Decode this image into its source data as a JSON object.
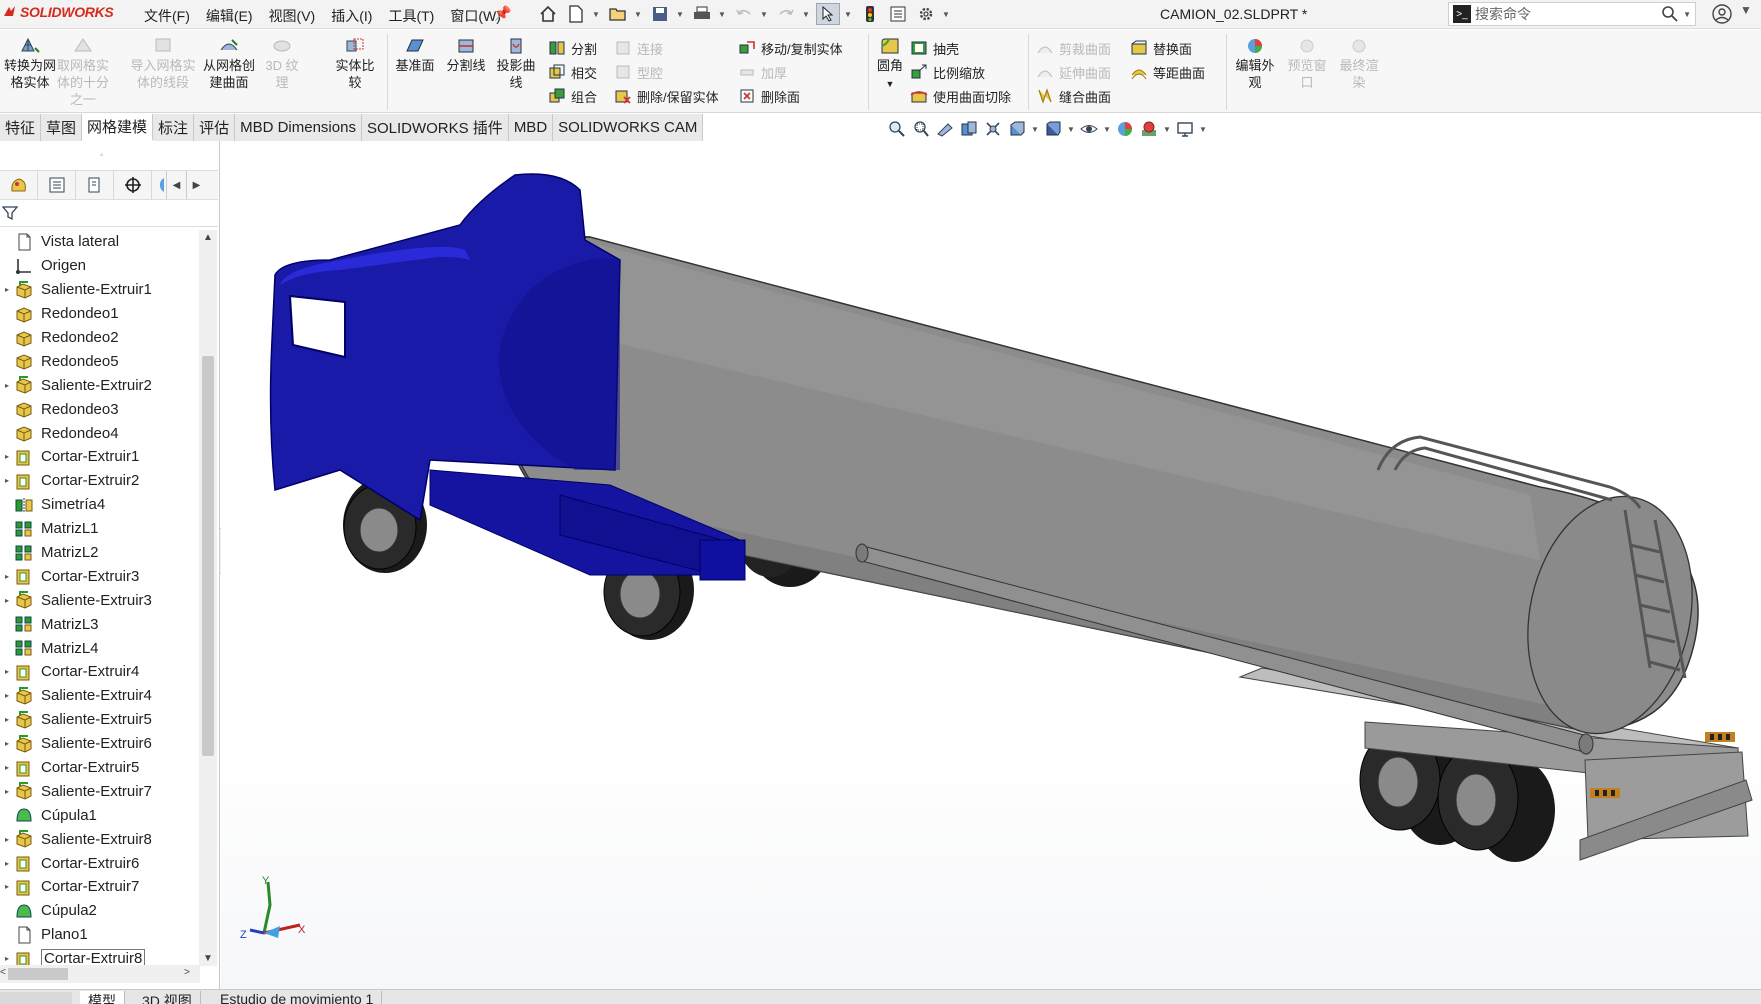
{
  "app": {
    "logo": "SOLIDWORKS",
    "document_title": "CAMION_02.SLDPRT *"
  },
  "menu": [
    "文件(F)",
    "编辑(E)",
    "视图(V)",
    "插入(I)",
    "工具(T)",
    "窗口(W)"
  ],
  "search": {
    "placeholder": "搜索命令"
  },
  "ribbon": {
    "big_buttons": [
      {
        "label1": "转换为网",
        "label2": "格实体",
        "enabled": true
      },
      {
        "label1": "取网格实",
        "label2": "体的十分之一",
        "enabled": false
      },
      {
        "label1": "导入网格实",
        "label2": "体的线段",
        "enabled": false
      },
      {
        "label1": "从网格创",
        "label2": "建曲面",
        "enabled": true
      },
      {
        "label1": "3D 纹",
        "label2": "理",
        "enabled": false
      },
      {
        "label1": "实体比",
        "label2": "较",
        "enabled": true
      },
      {
        "label1": "基准面",
        "label2": "",
        "enabled": true
      },
      {
        "label1": "分割线",
        "label2": "",
        "enabled": true
      },
      {
        "label1": "投影曲",
        "label2": "线",
        "enabled": true
      }
    ],
    "col1": [
      {
        "label": "分割",
        "enabled": true
      },
      {
        "label": "相交",
        "enabled": true
      },
      {
        "label": "组合",
        "enabled": true
      }
    ],
    "col2": [
      {
        "label": "连接",
        "enabled": false
      },
      {
        "label": "型腔",
        "enabled": false
      },
      {
        "label": "删除/保留实体",
        "enabled": true
      }
    ],
    "col3": [
      {
        "label": "移动/复制实体",
        "enabled": true
      },
      {
        "label": "加厚",
        "enabled": false
      },
      {
        "label": "删除面",
        "enabled": true
      }
    ],
    "fillet": {
      "label": "圆角"
    },
    "col4": [
      {
        "label": "抽壳",
        "enabled": true
      },
      {
        "label": "比例缩放",
        "enabled": true
      },
      {
        "label": "使用曲面切除",
        "enabled": true
      }
    ],
    "col5": [
      {
        "label": "剪裁曲面",
        "enabled": false
      },
      {
        "label": "延伸曲面",
        "enabled": false
      },
      {
        "label": "缝合曲面",
        "enabled": true
      }
    ],
    "col6": [
      {
        "label": "替换面",
        "enabled": true
      },
      {
        "label": "等距曲面",
        "enabled": true
      }
    ],
    "right_buttons": [
      {
        "label1": "编辑外",
        "label2": "观",
        "enabled": true
      },
      {
        "label1": "预览窗",
        "label2": "口",
        "enabled": false
      },
      {
        "label1": "最终渲",
        "label2": "染",
        "enabled": false
      }
    ]
  },
  "tabs": [
    "特征",
    "草图",
    "网格建模",
    "标注",
    "评估",
    "MBD Dimensions",
    "SOLIDWORKS 插件",
    "MBD",
    "SOLIDWORKS CAM"
  ],
  "active_tab": "网格建模",
  "feature_tree": [
    {
      "label": "Vista lateral",
      "icon": "annotation-view",
      "expandable": false
    },
    {
      "label": "Origen",
      "icon": "origin",
      "expandable": false
    },
    {
      "label": "Saliente-Extruir1",
      "icon": "boss-extrude",
      "expandable": true
    },
    {
      "label": "Redondeo1",
      "icon": "fillet",
      "expandable": false
    },
    {
      "label": "Redondeo2",
      "icon": "fillet",
      "expandable": false
    },
    {
      "label": "Redondeo5",
      "icon": "fillet",
      "expandable": false
    },
    {
      "label": "Saliente-Extruir2",
      "icon": "boss-extrude",
      "expandable": true
    },
    {
      "label": "Redondeo3",
      "icon": "fillet",
      "expandable": false
    },
    {
      "label": "Redondeo4",
      "icon": "fillet",
      "expandable": false
    },
    {
      "label": "Cortar-Extruir1",
      "icon": "cut-extrude",
      "expandable": true
    },
    {
      "label": "Cortar-Extruir2",
      "icon": "cut-extrude",
      "expandable": true
    },
    {
      "label": "Simetría4",
      "icon": "mirror",
      "expandable": false
    },
    {
      "label": "MatrizL1",
      "icon": "linear-pattern",
      "expandable": false
    },
    {
      "label": "MatrizL2",
      "icon": "linear-pattern",
      "expandable": false
    },
    {
      "label": "Cortar-Extruir3",
      "icon": "cut-extrude",
      "expandable": true
    },
    {
      "label": "Saliente-Extruir3",
      "icon": "boss-extrude",
      "expandable": true
    },
    {
      "label": "MatrizL3",
      "icon": "linear-pattern",
      "expandable": false
    },
    {
      "label": "MatrizL4",
      "icon": "linear-pattern",
      "expandable": false
    },
    {
      "label": "Cortar-Extruir4",
      "icon": "cut-extrude",
      "expandable": true
    },
    {
      "label": "Saliente-Extruir4",
      "icon": "boss-extrude",
      "expandable": true
    },
    {
      "label": "Saliente-Extruir5",
      "icon": "boss-extrude",
      "expandable": true
    },
    {
      "label": "Saliente-Extruir6",
      "icon": "boss-extrude",
      "expandable": true
    },
    {
      "label": "Cortar-Extruir5",
      "icon": "cut-extrude",
      "expandable": true
    },
    {
      "label": "Saliente-Extruir7",
      "icon": "boss-extrude",
      "expandable": true
    },
    {
      "label": "Cúpula1",
      "icon": "dome",
      "expandable": false
    },
    {
      "label": "Saliente-Extruir8",
      "icon": "boss-extrude",
      "expandable": true
    },
    {
      "label": "Cortar-Extruir6",
      "icon": "cut-extrude",
      "expandable": true
    },
    {
      "label": "Cortar-Extruir7",
      "icon": "cut-extrude",
      "expandable": true
    },
    {
      "label": "Cúpula2",
      "icon": "dome",
      "expandable": false
    },
    {
      "label": "Plano1",
      "icon": "plane",
      "expandable": false
    },
    {
      "label": "Cortar-Extruir8",
      "icon": "cut-extrude",
      "expandable": true,
      "boxed": true
    }
  ],
  "triad": {
    "x": "X",
    "y": "Y",
    "z": "Z"
  },
  "bottom_tabs": [
    "模型",
    "3D 视图",
    "Estudio de movimiento 1"
  ],
  "colors": {
    "cab": "#1a1aa8",
    "tank": "#8c8c8c",
    "logo": "#d52b1e"
  }
}
